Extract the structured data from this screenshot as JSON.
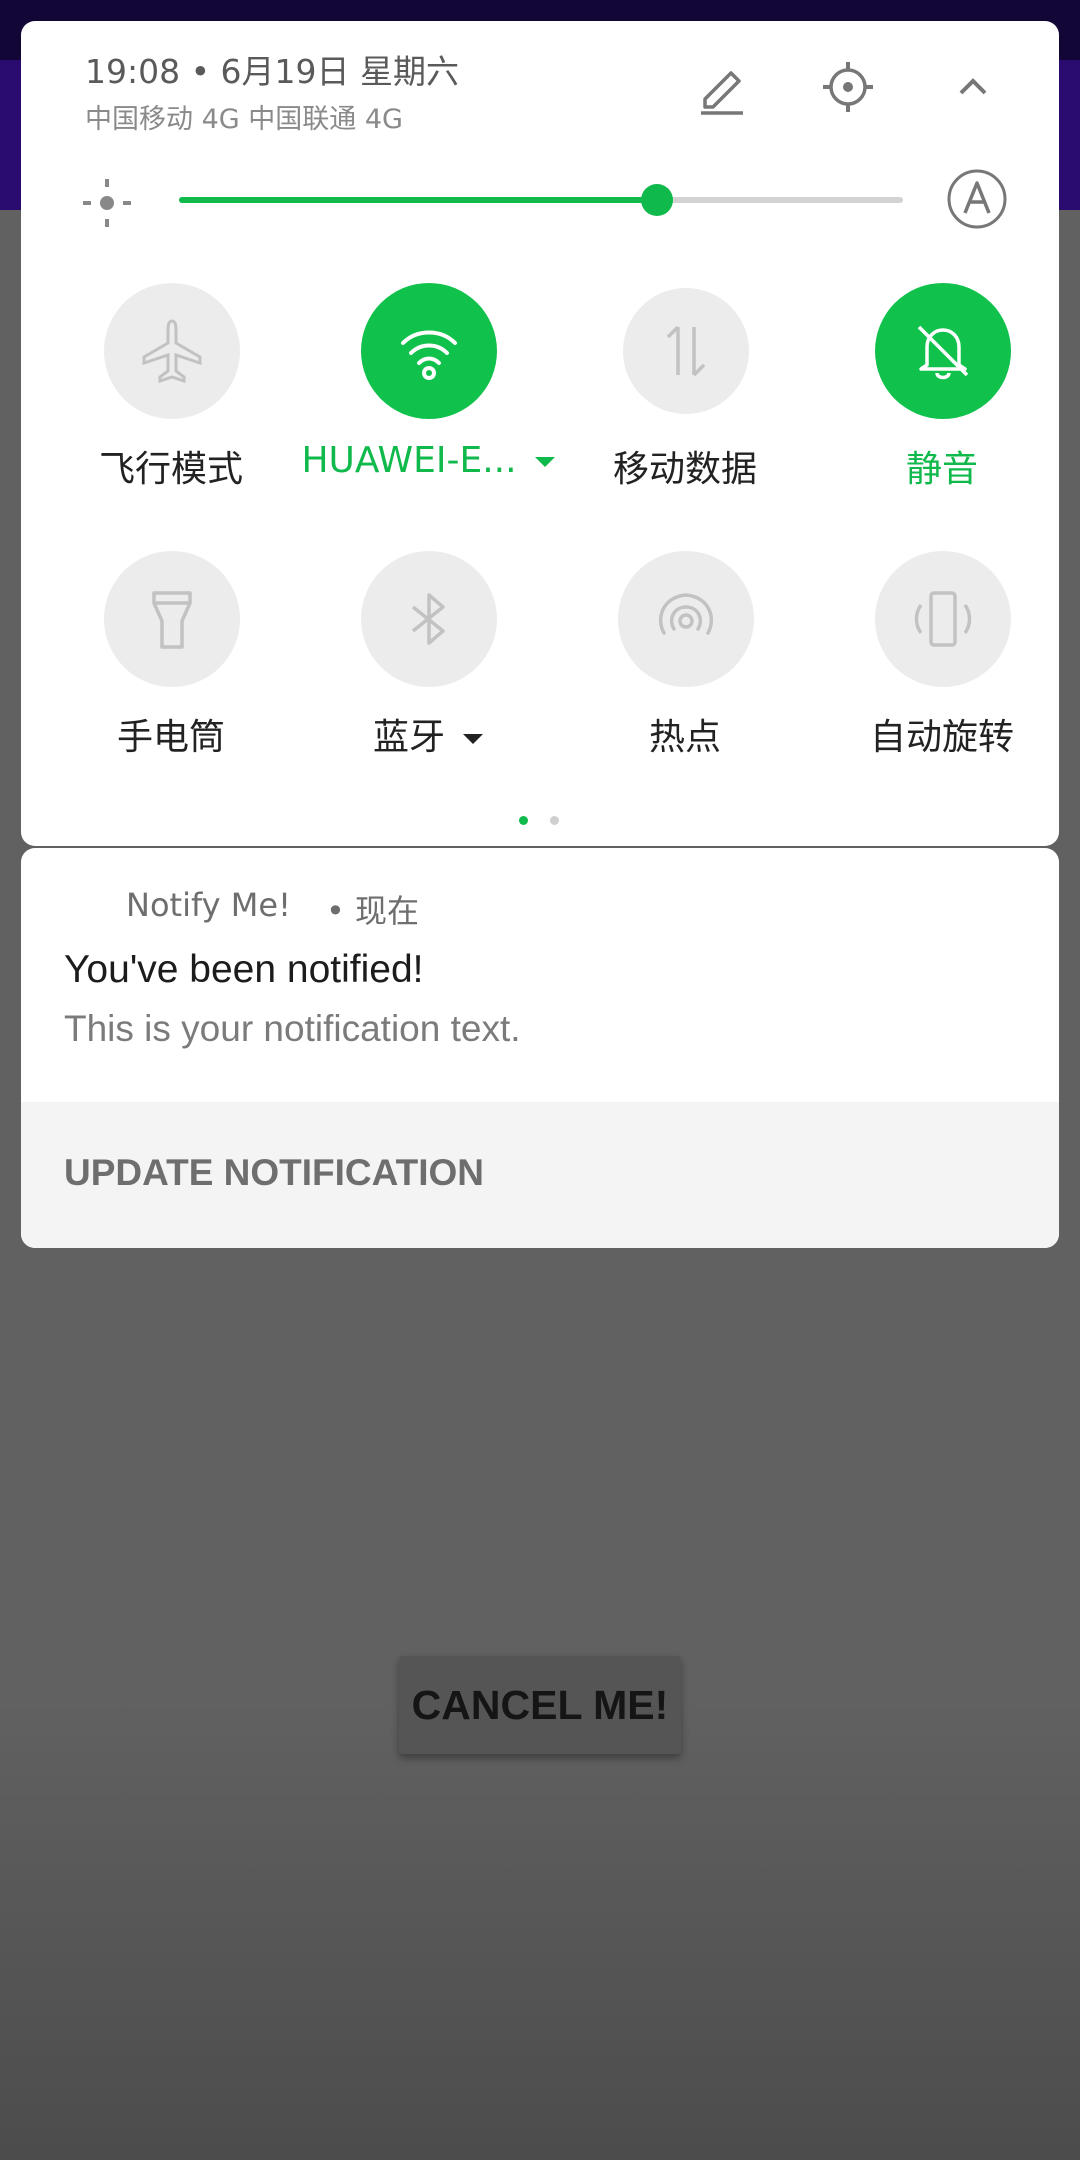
{
  "colors": {
    "accent": "#10b94b",
    "tile_off": "#ececec",
    "app_bar": "#2a0b70"
  },
  "status": {
    "date_line": "19:08 • 6月19日 星期六",
    "carrier_line": "中国移动 4G  中国联通 4G",
    "edit_icon": "pencil-icon",
    "settings_icon": "gear-icon",
    "collapse_icon": "chevron-up-icon"
  },
  "brightness": {
    "level_fraction": 0.66,
    "auto_icon": "auto-brightness-icon"
  },
  "tiles": [
    {
      "label": "飞行模式",
      "icon": "airplane-icon",
      "on": false
    },
    {
      "label": "HUAWEI-E...",
      "icon": "wifi-icon",
      "on": true,
      "dropdown": true
    },
    {
      "label": "移动数据",
      "icon": "mobile-data-icon",
      "on": false
    },
    {
      "label": "静音",
      "icon": "bell-off-icon",
      "on": true
    },
    {
      "label": "手电筒",
      "icon": "flashlight-icon",
      "on": false
    },
    {
      "label": "蓝牙",
      "icon": "bluetooth-icon",
      "on": false,
      "dropdown": true
    },
    {
      "label": "热点",
      "icon": "hotspot-icon",
      "on": false
    },
    {
      "label": "自动旋转",
      "icon": "auto-rotate-icon",
      "on": false
    }
  ],
  "pager": {
    "pages": 2,
    "current": 1
  },
  "notification": {
    "app_name": "Notify Me!",
    "time": "• 现在",
    "title": "You've been notified!",
    "text": "This is your notification text.",
    "action_label": "UPDATE NOTIFICATION"
  },
  "app": {
    "cancel_button_label": "CANCEL ME!"
  }
}
